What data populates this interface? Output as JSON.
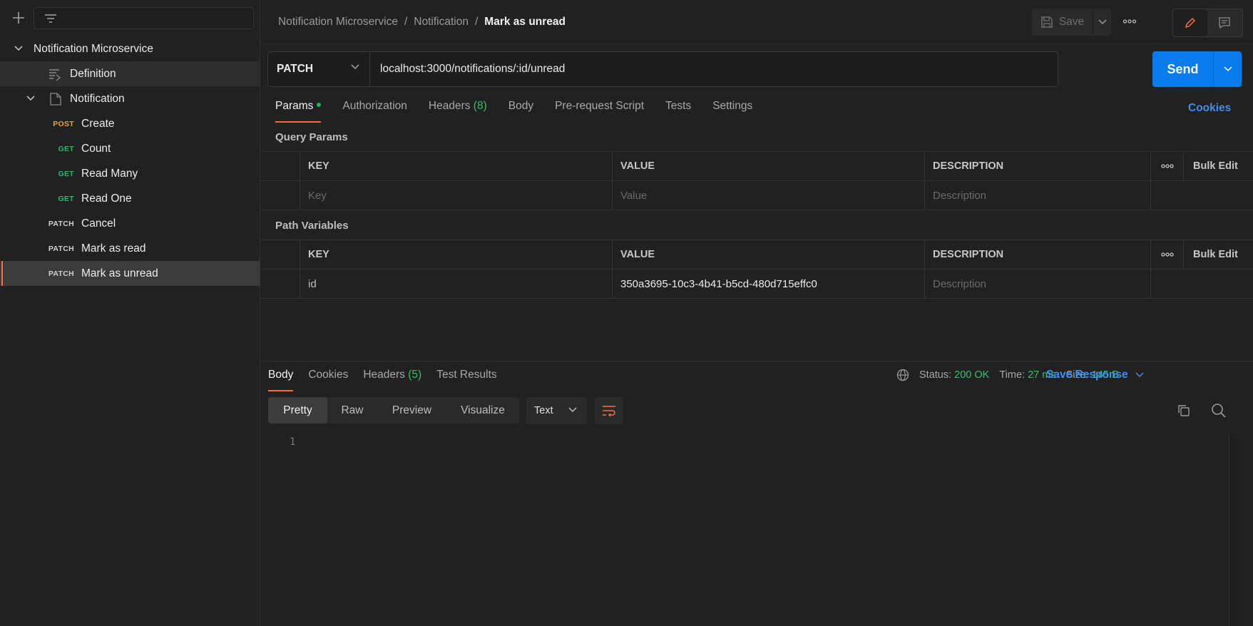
{
  "sidebar": {
    "collection_name": "Notification Microservice",
    "definition_label": "Definition",
    "folder_name": "Notification",
    "requests": [
      {
        "method": "POST",
        "label": "Create"
      },
      {
        "method": "GET",
        "label": "Count"
      },
      {
        "method": "GET",
        "label": "Read Many"
      },
      {
        "method": "GET",
        "label": "Read One"
      },
      {
        "method": "PATCH",
        "label": "Cancel"
      },
      {
        "method": "PATCH",
        "label": "Mark as read"
      },
      {
        "method": "PATCH",
        "label": "Mark as unread"
      }
    ]
  },
  "header": {
    "breadcrumb": [
      "Notification Microservice",
      "/",
      "Notification",
      "/",
      "Mark as unread"
    ],
    "save_label": "Save"
  },
  "request": {
    "method": "PATCH",
    "url": "localhost:3000/notifications/:id/unread",
    "send_label": "Send",
    "tabs": {
      "params": "Params",
      "authorization": "Authorization",
      "headers": "Headers",
      "headers_count": "(8)",
      "body": "Body",
      "prerequest": "Pre-request Script",
      "tests": "Tests",
      "settings": "Settings"
    },
    "cookies_label": "Cookies"
  },
  "query_params": {
    "title": "Query Params",
    "columns": [
      "KEY",
      "VALUE",
      "DESCRIPTION"
    ],
    "bulk_edit": "Bulk Edit",
    "placeholders": {
      "key": "Key",
      "value": "Value",
      "description": "Description"
    }
  },
  "path_variables": {
    "title": "Path Variables",
    "columns": [
      "KEY",
      "VALUE",
      "DESCRIPTION"
    ],
    "bulk_edit": "Bulk Edit",
    "rows": [
      {
        "key": "id",
        "value": "350a3695-10c3-4b41-b5cd-480d715effc0",
        "description_placeholder": "Description"
      }
    ]
  },
  "response": {
    "tabs": {
      "body": "Body",
      "cookies": "Cookies",
      "headers": "Headers",
      "headers_count": "(5)",
      "test_results": "Test Results"
    },
    "status_label": "Status:",
    "status_value": "200 OK",
    "time_label": "Time:",
    "time_value": "27 ms",
    "size_label": "Size:",
    "size_value": "145 B",
    "save_response": "Save Response",
    "views": [
      "Pretty",
      "Raw",
      "Preview",
      "Visualize"
    ],
    "format": "Text",
    "line_number": "1"
  },
  "colors": {
    "accent": "#ff6c37",
    "send_blue": "#097bed",
    "link_blue": "#3d8ff0",
    "success_green": "#3dbb73",
    "post_method": "#e6a53a",
    "get_method": "#39b26a"
  },
  "icons": [
    "plus-icon",
    "filter-icon",
    "chevron-down-icon",
    "definition-icon",
    "folder-icon",
    "save-icon",
    "more-icon",
    "pencil-icon",
    "comment-icon",
    "globe-icon",
    "wrap-icon",
    "copy-icon",
    "search-icon"
  ]
}
